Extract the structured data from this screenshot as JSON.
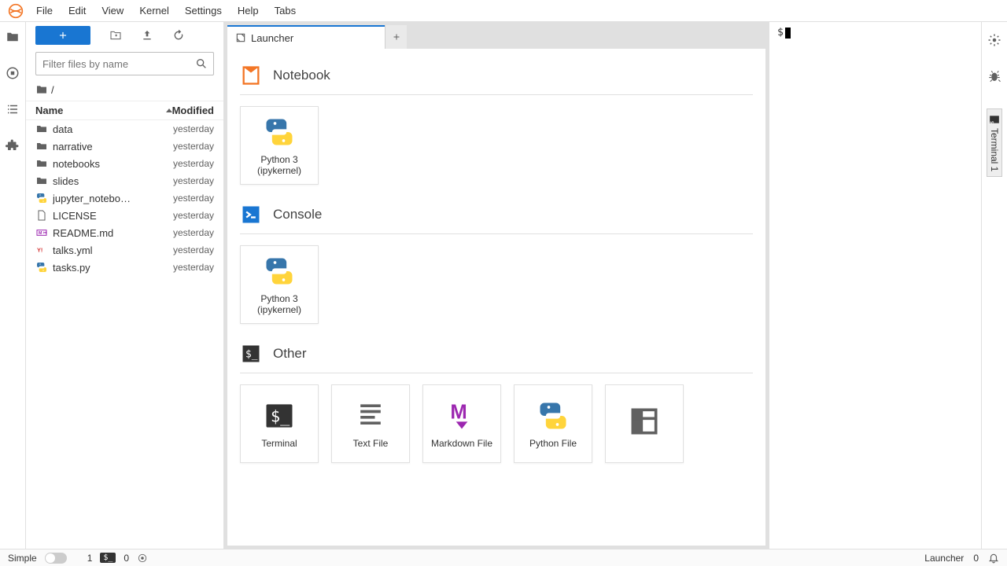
{
  "menu": [
    "File",
    "Edit",
    "View",
    "Kernel",
    "Settings",
    "Help",
    "Tabs"
  ],
  "filebrowser": {
    "filter_placeholder": "Filter files by name",
    "breadcrumb": "/",
    "header_name": "Name",
    "header_modified": "Modified",
    "files": [
      {
        "icon": "folder",
        "name": "data",
        "modified": "yesterday"
      },
      {
        "icon": "folder",
        "name": "narrative",
        "modified": "yesterday"
      },
      {
        "icon": "folder",
        "name": "notebooks",
        "modified": "yesterday"
      },
      {
        "icon": "folder",
        "name": "slides",
        "modified": "yesterday"
      },
      {
        "icon": "python",
        "name": "jupyter_notebo…",
        "modified": "yesterday"
      },
      {
        "icon": "file",
        "name": "LICENSE",
        "modified": "yesterday"
      },
      {
        "icon": "markdown",
        "name": "README.md",
        "modified": "yesterday"
      },
      {
        "icon": "yaml",
        "name": "talks.yml",
        "modified": "yesterday"
      },
      {
        "icon": "python",
        "name": "tasks.py",
        "modified": "yesterday"
      }
    ]
  },
  "tab": {
    "title": "Launcher"
  },
  "launcher": {
    "sections": [
      {
        "title": "Notebook",
        "icon": "notebook",
        "cards": [
          {
            "icon": "python",
            "label": "Python 3 (ipykernel)"
          }
        ]
      },
      {
        "title": "Console",
        "icon": "console",
        "cards": [
          {
            "icon": "python",
            "label": "Python 3 (ipykernel)"
          }
        ]
      },
      {
        "title": "Other",
        "icon": "terminal",
        "cards": [
          {
            "icon": "terminal-large",
            "label": "Terminal"
          },
          {
            "icon": "textfile",
            "label": "Text File"
          },
          {
            "icon": "markdown-large",
            "label": "Markdown File"
          },
          {
            "icon": "python",
            "label": "Python File"
          },
          {
            "icon": "component",
            "label": ""
          }
        ]
      }
    ]
  },
  "terminal": {
    "prompt": "$"
  },
  "rightbar_tab": "Terminal 1",
  "status": {
    "simple": "Simple",
    "terminals_count": "1",
    "kernels_count": "0",
    "launcher": "Launcher",
    "notif": "0"
  }
}
